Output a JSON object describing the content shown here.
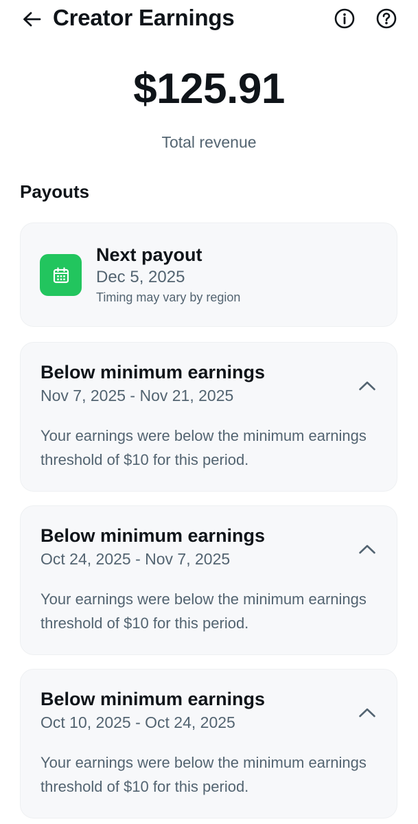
{
  "header": {
    "title": "Creator Earnings",
    "back_icon": "arrow-left-icon",
    "info_icon": "info-circle-icon",
    "help_icon": "question-circle-icon"
  },
  "summary": {
    "amount": "$125.91",
    "label": "Total revenue"
  },
  "payouts": {
    "section_title": "Payouts",
    "next_payout": {
      "title": "Next payout",
      "date": "Dec 5, 2025",
      "note": "Timing may vary by region",
      "icon": "calendar-icon",
      "icon_bg": "#22c55e"
    },
    "periods": [
      {
        "title": "Below minimum earnings",
        "range": "Nov 7, 2025 - Nov 21, 2025",
        "description": "Your earnings were below the minimum earnings threshold of $10 for this period.",
        "expanded": true
      },
      {
        "title": "Below minimum earnings",
        "range": "Oct 24, 2025 - Nov 7, 2025",
        "description": "Your earnings were below the minimum earnings threshold of $10 for this period.",
        "expanded": true
      },
      {
        "title": "Below minimum earnings",
        "range": "Oct 10, 2025 - Oct 24, 2025",
        "description": "Your earnings were below the minimum earnings threshold of $10 for this period.",
        "expanded": true
      }
    ]
  },
  "colors": {
    "text_primary": "#0f1419",
    "text_secondary": "#536471",
    "card_bg": "#f7f8fa",
    "accent_green": "#22c55e"
  }
}
